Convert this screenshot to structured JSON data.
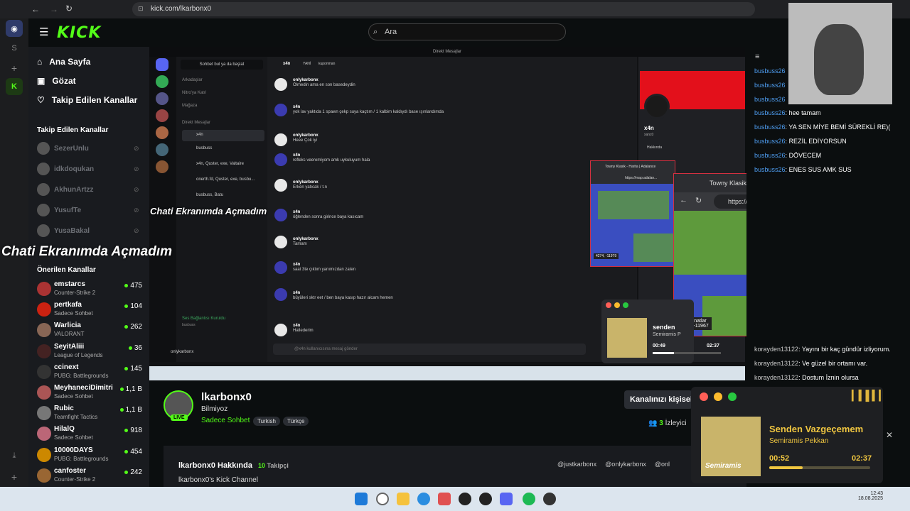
{
  "browser": {
    "url": "kick.com/lkarbonx0"
  },
  "kick": {
    "search_placeholder": "Ara",
    "nav": [
      "Ana Sayfa",
      "Gözat",
      "Takip Edilen Kanallar"
    ],
    "followed_heading": "Takip Edilen Kanallar",
    "followed": [
      "SezerUnlu",
      "idkdoqukan",
      "AkhunArtzz",
      "YusufTe",
      "YusaBakal"
    ],
    "recommended_heading": "Önerilen Kanallar",
    "recommended": [
      {
        "name": "emstarcs",
        "game": "Counter-Strike 2",
        "count": "475"
      },
      {
        "name": "pertkafa",
        "game": "Sadece Sohbet",
        "count": "104"
      },
      {
        "name": "Warlicia",
        "game": "VALORANT",
        "count": "262"
      },
      {
        "name": "SeyitAliii",
        "game": "League of Legends",
        "count": "36"
      },
      {
        "name": "ccinext",
        "game": "PUBG: Battlegrounds",
        "count": "145"
      },
      {
        "name": "MeyhaneciDimitri",
        "game": "Sadece Sohbet",
        "count": "1,1 B"
      },
      {
        "name": "Rubic",
        "game": "Teamfight Tactics",
        "count": "1,1 B"
      },
      {
        "name": "HilalQ",
        "game": "Sadece Sohbet",
        "count": "918"
      },
      {
        "name": "10000DAYS",
        "game": "PUBG: Battlegrounds",
        "count": "454"
      },
      {
        "name": "canfoster",
        "game": "Counter-Strike 2",
        "count": "242"
      }
    ]
  },
  "overlay_text": "Chati Ekranımda Açmadım",
  "discord": {
    "title": "Direkt Mesajlar",
    "search_btn": "Sohbet bul ya da başlat",
    "top_user": "x4n",
    "top_tabs": [
      "YANİ",
      "kuponman"
    ],
    "channels": [
      "Arkadaşlar",
      "Nitro'ya Katıl",
      "Mağaza"
    ],
    "dm_heading": "Direkt Mesajlar",
    "dms": [
      "x4n",
      "busbuss",
      "x4n, Quster, exe, Valtaire",
      "onerth.fd, Quster, exe, busbu...",
      "busbuss, Batu"
    ],
    "voice": "Ses Bağlantısı Kuruldu",
    "voice_sub": "busbuss",
    "self_name": "onlykarbonx",
    "input_placeholder": "@x4n kullanıcısına mesaj gönder",
    "messages": [
      {
        "u": "onlykarbonx",
        "t": "Ölmedin ama en son basedeydin"
      },
      {
        "u": "x4n",
        "t": "yok lav yaktıda 1 spawn çekp suya kaçtım / 1 kalbim kaldıydı base ışınlandımda"
      },
      {
        "u": "onlykarbonx",
        "t": "Heee Çok iyi"
      },
      {
        "u": "x4n",
        "t": "refleks veeremiyom amk uykuluyum hala"
      },
      {
        "u": "onlykarbonx",
        "t": "Erken yatıcak / t.n"
      },
      {
        "u": "x4n",
        "t": "öğlenden sonra girince baya kasıcam"
      },
      {
        "u": "onlykarbonx",
        "t": "Tamam"
      },
      {
        "u": "x4n",
        "t": "saat 3te çıktım yanımızdan zaten"
      },
      {
        "u": "x4n",
        "t": "büyüleri sktr eet / ben baya kasıp hazır alcam hemen"
      },
      {
        "u": "x4n",
        "t": "Hallederim"
      }
    ],
    "profile_name": "x4n",
    "profile_sub": "xanc0",
    "profile_section": "Hakkında"
  },
  "map": {
    "title": "Towny Klasik - Harita | Adalance",
    "url": "https://map.adalan...",
    "coords_label": "Koordinatlar",
    "coords": "4748, -11967",
    "small_coords": "4274, -11979"
  },
  "chat": [
    {
      "u": "busbuss26",
      "t": ""
    },
    {
      "u": "busbuss26",
      "t": ""
    },
    {
      "u": "busbuss26",
      "t": ""
    },
    {
      "u": "busbuss26",
      "t": "hee tamam"
    },
    {
      "u": "busbuss26",
      "t": "YA SEN MİYE BEMİ SÜREKLİ RE)("
    },
    {
      "u": "busbuss26",
      "t": "REZİL EDİYORSUN"
    },
    {
      "u": "busbuss26",
      "t": "DÖVECEM"
    },
    {
      "u": "busbuss26",
      "t": "ENES SUS AMK SUS"
    }
  ],
  "chat_bottom": [
    {
      "u": "korayden13122",
      "t": "Yayını bir kaç gündür izliyorum."
    },
    {
      "u": "korayden13122",
      "t": "Ve güzel bir ortamı var."
    },
    {
      "u": "korayden13122",
      "t": "Dostum İznin olursa"
    }
  ],
  "channel": {
    "name": "lkarbonx0",
    "title": "Bilmiyoz",
    "category": "Sadece Sohbet",
    "tags": [
      "Turkish",
      "Türkçe"
    ],
    "live": "LIVE",
    "customize": "Kanalınızı kişisel",
    "viewers": "3",
    "viewers_label": "İzleyici",
    "about_title": "lkarbonx0 Hakkında",
    "followers": "10",
    "followers_label": "Takipçi",
    "description": "lkarbonx0's Kick Channel",
    "socials": [
      "@justkarbonx",
      "@onlykarbonx",
      "@onl"
    ]
  },
  "music_small": {
    "title": "senden",
    "artist": "Semiramis P",
    "elapsed": "00:49",
    "total": "02:37",
    "progress": 0.31
  },
  "music": {
    "title": "Senden Vazgeçemem",
    "artist": "Semiramis Pekkan",
    "elapsed": "00:52",
    "total": "02:37",
    "progress": 0.33,
    "cover_text": "Semiramis"
  },
  "taskbar": {
    "time": "12:43",
    "date": "18.08.2025"
  },
  "colors": {
    "kick_green": "#53fc18",
    "chat_user": "#4e9df0",
    "map_border": "#d43040"
  }
}
